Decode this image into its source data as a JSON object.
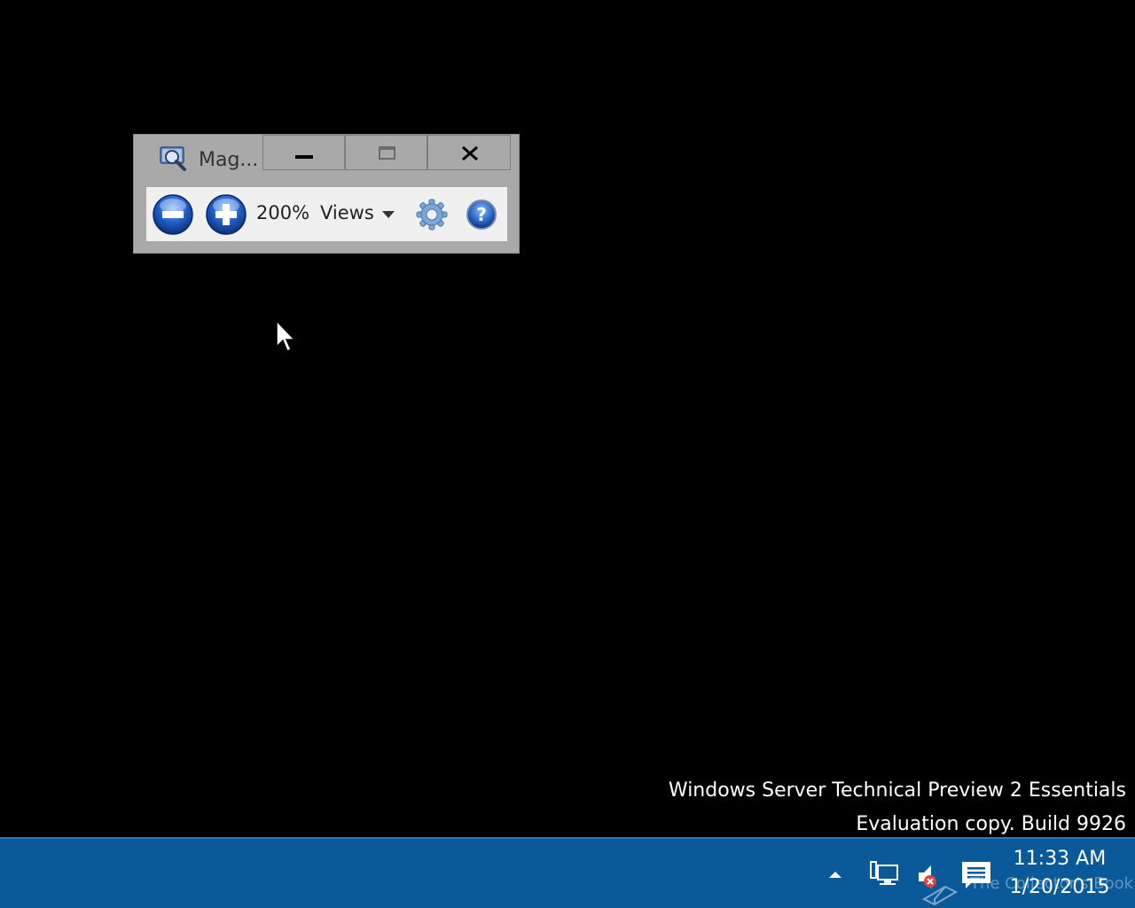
{
  "magnifier": {
    "title": "Mag...",
    "zoom_level": "200%",
    "views_label": "Views",
    "icons": {
      "app": "magnifier-app-icon",
      "minimize": "minimize-icon",
      "maximize": "maximize-icon",
      "close": "close-icon",
      "zoom_out": "zoom-out-icon",
      "zoom_in": "zoom-in-icon",
      "settings": "gear-icon",
      "help": "help-icon"
    }
  },
  "watermark": {
    "line1": "Windows Server Technical Preview 2 Essentials",
    "line2": "Evaluation copy. Build 9926"
  },
  "taskbar": {
    "clock_time": "11:33 AM",
    "clock_date": "1/20/2015",
    "overlay_text": "The Collector's Book",
    "icons": {
      "tray_expand": "chevron-up-icon",
      "network": "network-icon",
      "volume": "volume-muted-icon",
      "action_center": "action-center-icon"
    }
  },
  "colors": {
    "taskbar": "#0a5a9a",
    "desktop": "#000000",
    "window_frame": "#a9a9a9",
    "button_blue": "#1f5fc6"
  }
}
